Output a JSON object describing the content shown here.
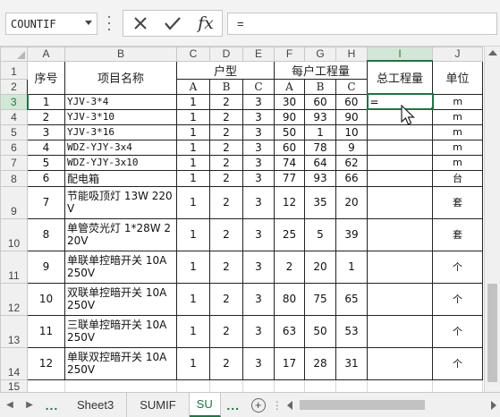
{
  "formula_bar": {
    "name_box": "COUNTIF",
    "formula": "=",
    "fx_label": "fx"
  },
  "columns": [
    "A",
    "B",
    "C",
    "D",
    "E",
    "F",
    "G",
    "H",
    "I",
    "J"
  ],
  "selected_column": "I",
  "row_numbers": [
    "1",
    "2",
    "3",
    "4",
    "5",
    "6",
    "7",
    "8",
    "9",
    "10",
    "11",
    "12",
    "13",
    "14",
    "15"
  ],
  "selected_row": "3",
  "header": {
    "seq": "序号",
    "name": "项目名称",
    "house_type": "户型",
    "per_house": "每户工程量",
    "total": "总工程量",
    "unit": "单位",
    "sub": [
      "A",
      "B",
      "C",
      "A",
      "B",
      "C"
    ]
  },
  "active_cell_value": "=",
  "rows": [
    {
      "seq": "1",
      "name": "YJV-3*4",
      "a": "1",
      "b": "2",
      "c": "3",
      "pa": "30",
      "pb": "60",
      "pc": "60",
      "unit": "m"
    },
    {
      "seq": "2",
      "name": "YJV-3*10",
      "a": "1",
      "b": "2",
      "c": "3",
      "pa": "90",
      "pb": "93",
      "pc": "90",
      "unit": "m"
    },
    {
      "seq": "3",
      "name": "YJV-3*16",
      "a": "1",
      "b": "2",
      "c": "3",
      "pa": "50",
      "pb": "1",
      "pc": "10",
      "unit": "m"
    },
    {
      "seq": "4",
      "name": "WDZ-YJY-3x4",
      "a": "1",
      "b": "2",
      "c": "3",
      "pa": "60",
      "pb": "78",
      "pc": "9",
      "unit": "m"
    },
    {
      "seq": "5",
      "name": "WDZ-YJY-3x10",
      "a": "1",
      "b": "2",
      "c": "3",
      "pa": "74",
      "pb": "64",
      "pc": "62",
      "unit": "m"
    },
    {
      "seq": "6",
      "name": "配电箱",
      "a": "1",
      "b": "2",
      "c": "3",
      "pa": "77",
      "pb": "93",
      "pc": "66",
      "unit": "台"
    },
    {
      "seq": "7",
      "name": "节能吸顶灯 13W 220V",
      "a": "1",
      "b": "2",
      "c": "3",
      "pa": "12",
      "pb": "35",
      "pc": "20",
      "unit": "套"
    },
    {
      "seq": "8",
      "name": "单管荧光灯 1*28W 220V",
      "a": "1",
      "b": "2",
      "c": "3",
      "pa": "25",
      "pb": "5",
      "pc": "39",
      "unit": "套"
    },
    {
      "seq": "9",
      "name": "单联单控暗开关 10A 250V",
      "a": "1",
      "b": "2",
      "c": "3",
      "pa": "2",
      "pb": "20",
      "pc": "1",
      "unit": "个"
    },
    {
      "seq": "10",
      "name": "双联单控暗开关 10A 250V",
      "a": "1",
      "b": "2",
      "c": "3",
      "pa": "80",
      "pb": "75",
      "pc": "65",
      "unit": "个"
    },
    {
      "seq": "11",
      "name": "三联单控暗开关 10A 250V",
      "a": "1",
      "b": "2",
      "c": "3",
      "pa": "63",
      "pb": "50",
      "pc": "53",
      "unit": "个"
    },
    {
      "seq": "12",
      "name": "单联双控暗开关 10A 250V",
      "a": "1",
      "b": "2",
      "c": "3",
      "pa": "17",
      "pb": "28",
      "pc": "31",
      "unit": "个"
    }
  ],
  "tabs": {
    "more_left": "...",
    "items": [
      "Sheet3",
      "SUMIF",
      "SU"
    ],
    "active_index": 2,
    "more_right": "..."
  }
}
